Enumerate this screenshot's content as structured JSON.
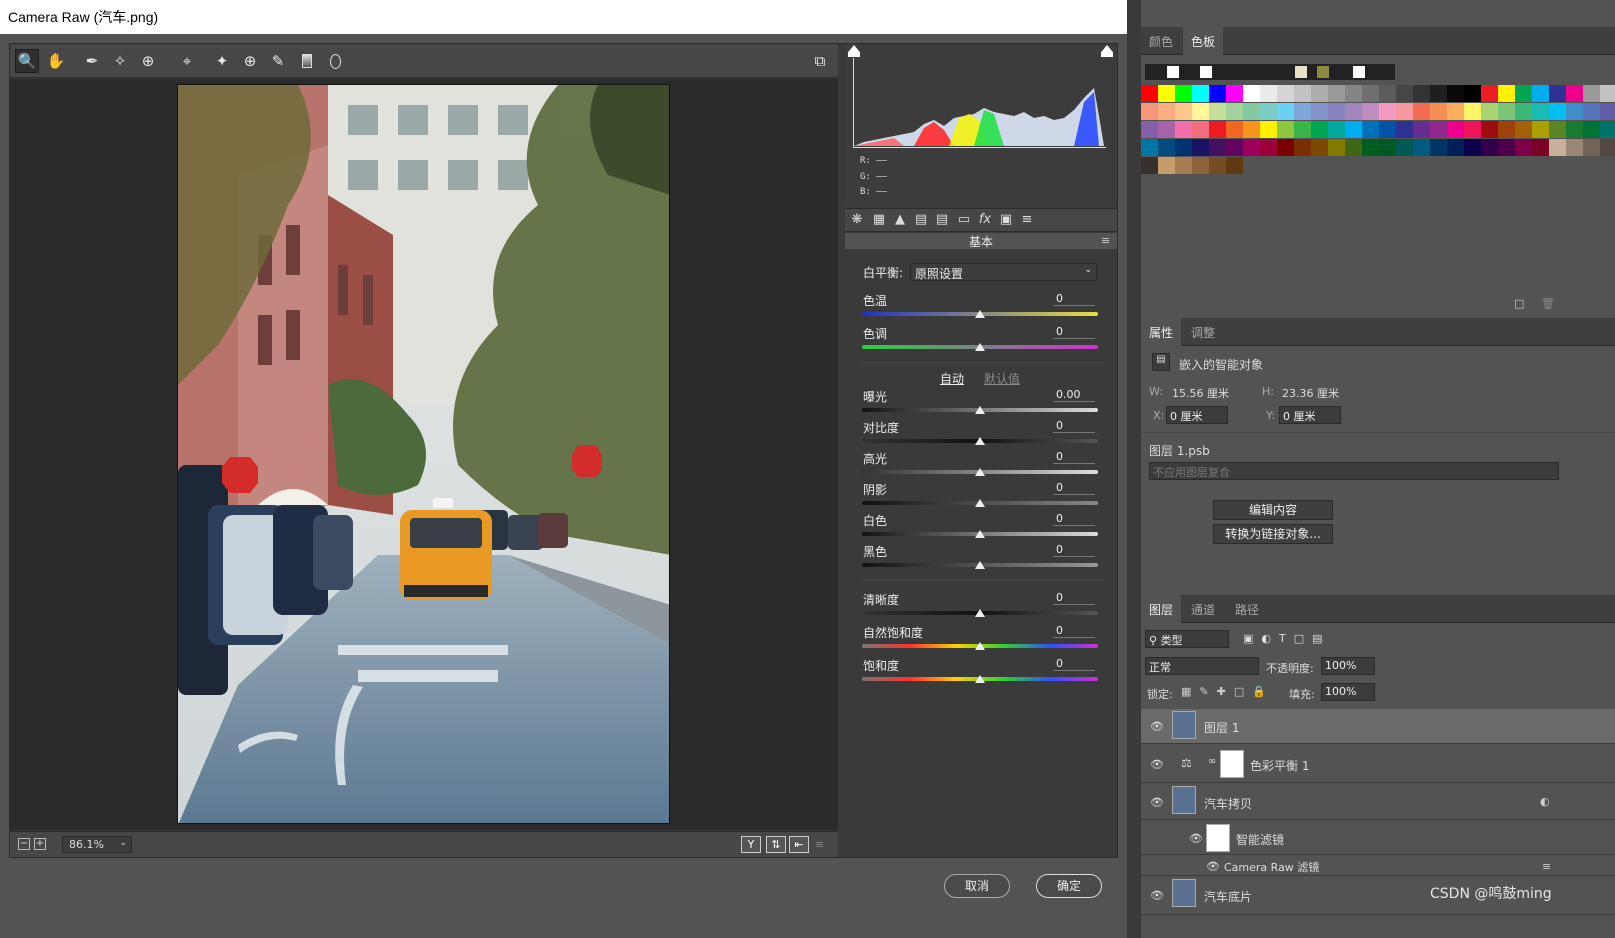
{
  "window": {
    "title": "Camera Raw (汽车.png)"
  },
  "toolbar": {
    "tools": [
      "zoom-icon",
      "hand-icon",
      "white-balance-icon",
      "color-sampler-icon",
      "targeted-adjustment-icon",
      "crop-icon",
      "spot-removal-icon",
      "red-eye-icon",
      "adjustment-brush-icon",
      "graduated-filter-icon",
      "radial-filter-icon"
    ]
  },
  "status": {
    "zoom": "86.1%",
    "minus": "−",
    "plus": "+",
    "view_y": "Y"
  },
  "histogram": {
    "r": "R:  ——",
    "g": "G:  ——",
    "b": "B:  ——"
  },
  "panel": {
    "title": "基本",
    "wb_label": "白平衡:",
    "wb_value": "原照设置",
    "temp_label": "色温",
    "temp_value": "0",
    "tint_label": "色调",
    "tint_value": "0",
    "auto": "自动",
    "default": "默认值",
    "sliders": [
      {
        "label": "曝光",
        "value": "0.00"
      },
      {
        "label": "对比度",
        "value": "0"
      },
      {
        "label": "高光",
        "value": "0"
      },
      {
        "label": "阴影",
        "value": "0"
      },
      {
        "label": "白色",
        "value": "0"
      },
      {
        "label": "黑色",
        "value": "0"
      },
      {
        "label": "清晰度",
        "value": "0"
      },
      {
        "label": "自然饱和度",
        "value": "0"
      },
      {
        "label": "饱和度",
        "value": "0"
      }
    ]
  },
  "buttons": {
    "cancel": "取消",
    "ok": "确定"
  },
  "swatches_panel": {
    "tabs": [
      "颜色",
      "色板"
    ],
    "colors": [
      [
        "#ff0000",
        "#ffff00",
        "#00ff00",
        "#00ffff",
        "#0000ff",
        "#ff00ff",
        "#ffffff",
        "#ebebeb",
        "#d6d6d6",
        "#c2c2c2",
        "#adadad",
        "#999999",
        "#858585",
        "#707070",
        "#5c5c5c",
        "#474747",
        "#333333",
        "#1f1f1f",
        "#0a0a0a",
        "#000000",
        "#ee1d24",
        "#fff100",
        "#00a650",
        "#00aeef",
        "#2f3192",
        "#ed008c",
        "#999999",
        "#c2c2c2"
      ],
      [
        "#f7977a",
        "#f9ad81",
        "#fdc68a",
        "#fff79a",
        "#c4df9b",
        "#a2d39c",
        "#82ca9d",
        "#7bcdc8",
        "#6ecff6",
        "#7ea7d8",
        "#8493ca",
        "#8882be",
        "#a187be",
        "#bc8dbf",
        "#f49ac2",
        "#f6989d",
        "#f26c4f",
        "#f68e55",
        "#fbaf5c",
        "#fff467",
        "#acd372",
        "#7cc576",
        "#3bb878",
        "#1abbb4",
        "#00bff3",
        "#438cca",
        "#5574b9",
        "#605ca8"
      ],
      [
        "#855fa8",
        "#a763a8",
        "#f06eaa",
        "#f26d7d",
        "#ed1c24",
        "#f26522",
        "#f7941d",
        "#fff200",
        "#8dc73f",
        "#39b54a",
        "#00a651",
        "#00a99d",
        "#00aeef",
        "#0072bc",
        "#0054a6",
        "#2e3192",
        "#662d91",
        "#92278f",
        "#ec008c",
        "#ed145b",
        "#9e0b0f",
        "#a0410d",
        "#a36209",
        "#aba000",
        "#598527",
        "#1a7b30",
        "#007236",
        "#00746b"
      ],
      [
        "#0076a3",
        "#004b80",
        "#003471",
        "#1b1464",
        "#440e62",
        "#630460",
        "#9e005d",
        "#9e0039",
        "#790000",
        "#7b2e00",
        "#7d4900",
        "#827b00",
        "#406618",
        "#005e20",
        "#005826",
        "#005952",
        "#005b7f",
        "#003663",
        "#002157",
        "#0d004c",
        "#32004b",
        "#4b0049",
        "#7b0046",
        "#7a0026",
        "#c7b299",
        "#998675",
        "#736357",
        "#534741"
      ],
      [
        "#37302d",
        "#c69c6d",
        "#a67c52",
        "#8c6239",
        "#754c24",
        "#603913"
      ]
    ]
  },
  "properties_panel": {
    "tabs": [
      "属性",
      "调整"
    ],
    "type": "嵌入的智能对象",
    "w_label": "W:",
    "w": "15.56 厘米",
    "h_label": "H:",
    "h": "23.36 厘米",
    "x_label": "X:",
    "x": "0 厘米",
    "y_label": "Y:",
    "y": "0 厘米",
    "layer_file": "图层 1.psb",
    "comp": "不应用图层复合",
    "edit_btn": "编辑内容",
    "convert_btn": "转换为链接对象..."
  },
  "layers_panel": {
    "tabs": [
      "图层",
      "通道",
      "路径"
    ],
    "filter": "类型",
    "blend": "正常",
    "opacity_label": "不透明度:",
    "opacity": "100%",
    "lock_label": "锁定:",
    "fill_label": "填充:",
    "fill": "100%",
    "layers": [
      {
        "name": "图层 1"
      },
      {
        "name": "色彩平衡 1"
      },
      {
        "name": "汽车拷贝"
      },
      {
        "name": "智能滤镜"
      },
      {
        "name": "Camera Raw 滤镜"
      },
      {
        "name": "汽车底片"
      }
    ]
  },
  "watermark": "CSDN @鸣鼓ming"
}
